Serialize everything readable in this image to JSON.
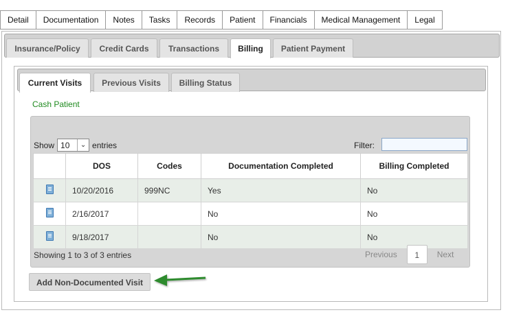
{
  "top_tabs": [
    "Detail",
    "Documentation",
    "Notes",
    "Tasks",
    "Records",
    "Patient",
    "Financials",
    "Medical Management",
    "Legal"
  ],
  "sub_tabs": [
    "Insurance/Policy",
    "Credit Cards",
    "Transactions",
    "Billing",
    "Patient Payment"
  ],
  "sub_tabs_active": "Billing",
  "visit_tabs": [
    "Current Visits",
    "Previous Visits",
    "Billing Status"
  ],
  "visit_tabs_active": "Current Visits",
  "patient_type": "Cash Patient",
  "table": {
    "show_label": "Show",
    "entries_value": "10",
    "entries_label": "entries",
    "filter_label": "Filter:",
    "filter_value": "",
    "columns": [
      "",
      "DOS",
      "Codes",
      "Documentation Completed",
      "Billing Completed"
    ],
    "rows": [
      {
        "icon": "document-icon",
        "dos": "10/20/2016",
        "codes": "999NC",
        "doc_completed": "Yes",
        "billing_completed": "No"
      },
      {
        "icon": "document-icon",
        "dos": "2/16/2017",
        "codes": "",
        "doc_completed": "No",
        "billing_completed": "No"
      },
      {
        "icon": "document-icon",
        "dos": "9/18/2017",
        "codes": "",
        "doc_completed": "No",
        "billing_completed": "No"
      }
    ],
    "info": "Showing 1 to 3 of 3 entries",
    "pager": {
      "previous": "Previous",
      "page": "1",
      "next": "Next"
    }
  },
  "add_button": "Add Non-Documented Visit",
  "colors": {
    "accent_green": "#1f8a1f",
    "arrow_green": "#2e8b2e"
  }
}
